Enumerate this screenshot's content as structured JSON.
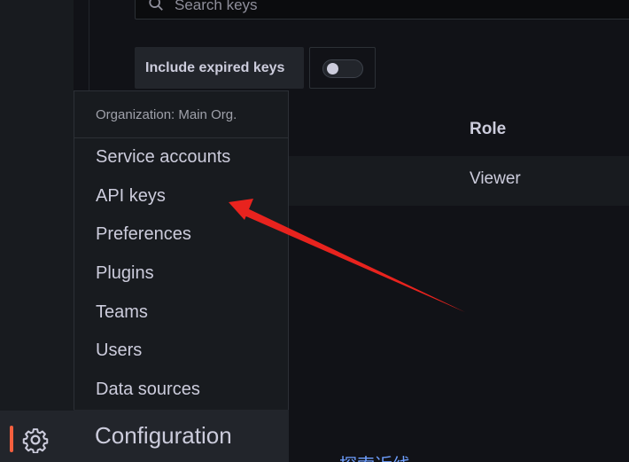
{
  "search": {
    "placeholder": "Search keys",
    "value": ""
  },
  "filters": {
    "include_expired_label": "Include expired keys",
    "include_expired_on": false
  },
  "table": {
    "role_header": "Role",
    "rows": [
      {
        "role": "Viewer"
      }
    ]
  },
  "submenu": {
    "header": "Organization: Main Org.",
    "items": [
      {
        "label": "Service accounts"
      },
      {
        "label": "API keys"
      },
      {
        "label": "Preferences"
      },
      {
        "label": "Plugins"
      },
      {
        "label": "Teams"
      },
      {
        "label": "Users"
      },
      {
        "label": "Data sources"
      }
    ],
    "section_title": "Configuration"
  },
  "nav": {
    "active_icon": "gear-icon"
  },
  "bottom_link": {
    "text": "探索近线"
  },
  "colors": {
    "accent": "#f55f3e",
    "annotation": "#e8231e",
    "link": "#6e9fff"
  }
}
